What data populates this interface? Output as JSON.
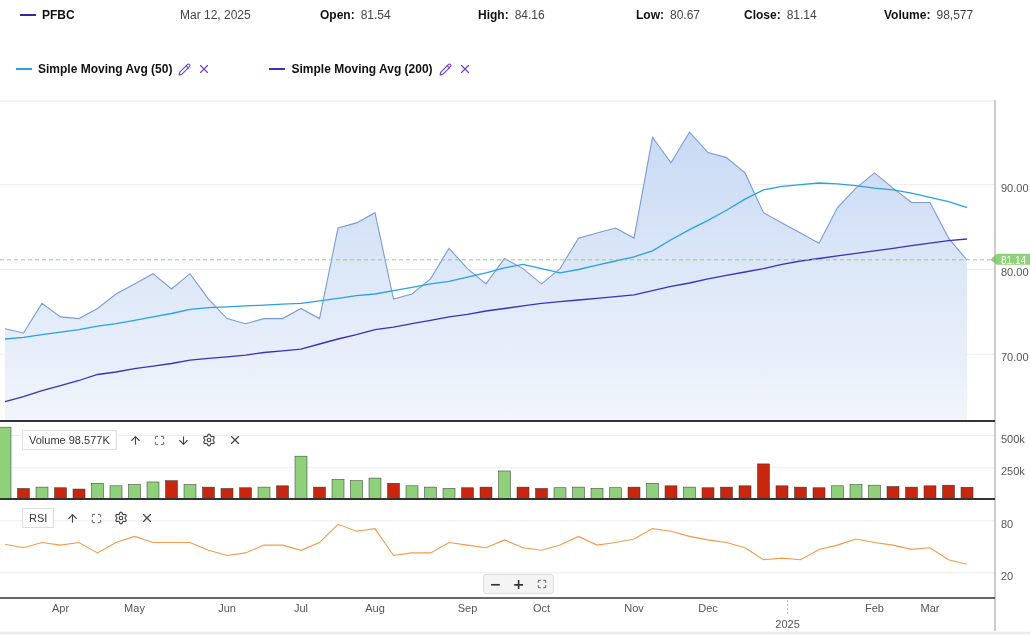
{
  "header": {
    "date": "Mar 12, 2025",
    "stats": [
      {
        "label": "Open:",
        "value": "81.54"
      },
      {
        "label": "High:",
        "value": "84.16"
      },
      {
        "label": "Low:",
        "value": "80.67"
      },
      {
        "label": "Close:",
        "value": "81.14"
      },
      {
        "label": "Volume:",
        "value": "98,577"
      }
    ]
  },
  "price_panel": {
    "chart_data": {
      "type": "line",
      "grid": true,
      "ref_lines": [
        {
          "axis": "y",
          "value": 81.14,
          "label": "81.14",
          "color": "#8fd07a"
        }
      ],
      "ylim": [
        62,
        100
      ],
      "yticks": [
        {
          "value": 70,
          "label": "70.00"
        },
        {
          "value": 80,
          "label": "80.00"
        },
        {
          "value": 90,
          "label": "90.00"
        }
      ],
      "series": [
        {
          "name": "PFBC",
          "type": "area",
          "color": "#7b9bd6",
          "values": [
            73.0,
            72.5,
            76.0,
            74.4,
            74.2,
            75.4,
            77.1,
            78.3,
            79.5,
            77.7,
            79.5,
            76.5,
            74.2,
            73.6,
            74.2,
            74.2,
            75.4,
            74.2,
            84.9,
            85.5,
            86.7,
            76.5,
            77.1,
            78.9,
            82.5,
            80.1,
            78.3,
            81.3,
            80.1,
            78.3,
            80.1,
            83.7,
            84.3,
            84.9,
            83.7,
            95.6,
            92.6,
            96.2,
            93.8,
            93.2,
            91.4,
            86.7,
            85.5,
            84.3,
            83.1,
            87.3,
            89.6,
            91.4,
            89.6,
            87.9,
            87.9,
            83.7,
            81.1
          ]
        },
        {
          "name": "Simple Moving Avg (50)",
          "type": "line",
          "color": "#2aa0e8",
          "values": [
            71.8,
            72.0,
            72.3,
            72.6,
            72.9,
            73.3,
            73.6,
            74.0,
            74.4,
            74.8,
            75.3,
            75.5,
            75.6,
            75.7,
            75.8,
            75.9,
            76.0,
            76.3,
            76.6,
            76.9,
            77.1,
            77.5,
            77.9,
            78.3,
            78.6,
            79.1,
            79.6,
            80.2,
            80.6,
            80.1,
            79.6,
            80.0,
            80.5,
            81.0,
            81.5,
            82.2,
            83.5,
            84.7,
            85.8,
            87.0,
            88.3,
            89.4,
            89.8,
            90.0,
            90.2,
            90.1,
            89.9,
            89.6,
            89.4,
            89.0,
            88.5,
            88.0,
            87.3
          ]
        },
        {
          "name": "Simple Moving Avg (200)",
          "type": "line",
          "color": "#3b2fc4",
          "values": [
            64.4,
            65.0,
            65.7,
            66.3,
            66.9,
            67.6,
            67.9,
            68.3,
            68.6,
            68.9,
            69.3,
            69.5,
            69.7,
            69.9,
            70.2,
            70.4,
            70.6,
            71.2,
            71.8,
            72.3,
            72.9,
            73.2,
            73.6,
            74.0,
            74.4,
            74.7,
            75.1,
            75.4,
            75.7,
            76.0,
            76.2,
            76.4,
            76.6,
            76.8,
            77.0,
            77.5,
            78.0,
            78.4,
            78.9,
            79.3,
            79.7,
            80.1,
            80.6,
            81.0,
            81.3,
            81.6,
            81.9,
            82.2,
            82.5,
            82.8,
            83.1,
            83.4,
            83.6
          ]
        }
      ]
    }
  },
  "volume_panel": {
    "label": "Volume 98.577K",
    "chart_data": {
      "type": "bar",
      "stacked": true,
      "grid": true,
      "ylim": [
        0,
        605
      ],
      "yticks": [
        {
          "value": 250,
          "label": "250k"
        },
        {
          "value": 500,
          "label": "500k"
        }
      ],
      "series": [
        {
          "color": "#8fd07a",
          "values": [
            565,
            null,
            100,
            null,
            null,
            130,
            110,
            120,
            140,
            null,
            120,
            null,
            null,
            null,
            100,
            null,
            340,
            null,
            160,
            150,
            170,
            null,
            110,
            100,
            90,
            null,
            null,
            225,
            null,
            null,
            95,
            100,
            90,
            95,
            null,
            130,
            null,
            100,
            null,
            null,
            null,
            null,
            null,
            null,
            null,
            110,
            120,
            115,
            null,
            null,
            null,
            null,
            null
          ]
        },
        {
          "color": "#c8260f",
          "values": [
            null,
            90,
            null,
            95,
            85,
            null,
            null,
            null,
            null,
            150,
            null,
            100,
            90,
            95,
            null,
            110,
            null,
            100,
            null,
            null,
            null,
            130,
            null,
            null,
            null,
            95,
            100,
            null,
            100,
            90,
            null,
            null,
            null,
            null,
            100,
            null,
            110,
            null,
            95,
            100,
            110,
            280,
            110,
            100,
            95,
            null,
            null,
            null,
            105,
            100,
            110,
            115,
            99
          ]
        }
      ]
    }
  },
  "rsi_panel": {
    "chart_data": {
      "type": "line",
      "categories": [
        null,
        null,
        null,
        "Apr",
        null,
        null,
        null,
        "May",
        null,
        null,
        null,
        null,
        "Jun",
        null,
        null,
        null,
        "Jul",
        null,
        null,
        null,
        "Aug",
        null,
        null,
        null,
        null,
        "Sep",
        null,
        null,
        null,
        "Oct",
        null,
        null,
        null,
        null,
        "Nov",
        null,
        null,
        null,
        "Dec",
        null,
        null,
        null,
        null,
        null,
        null,
        null,
        null,
        "Feb",
        null,
        null,
        "Mar",
        null,
        null
      ],
      "grid": true,
      "ylim": [
        -9,
        104
      ],
      "yticks": [
        20,
        80
      ],
      "series": [
        {
          "name": "RSI",
          "color": "#f39a4a",
          "values": [
            53,
            49,
            55,
            52,
            55,
            43,
            55,
            62,
            55,
            55,
            55,
            46,
            40,
            43,
            52,
            52,
            46,
            55,
            76,
            68,
            71,
            40,
            43,
            43,
            55,
            52,
            49,
            58,
            49,
            46,
            52,
            62,
            52,
            55,
            59,
            71,
            68,
            62,
            58,
            55,
            49,
            35,
            37,
            35,
            47,
            52,
            59,
            55,
            52,
            47,
            49,
            35,
            30
          ]
        }
      ]
    }
  },
  "time_axis": {
    "year_label": "2025"
  },
  "zoom_controls": {
    "zoom_out": "−",
    "zoom_in": "+"
  }
}
